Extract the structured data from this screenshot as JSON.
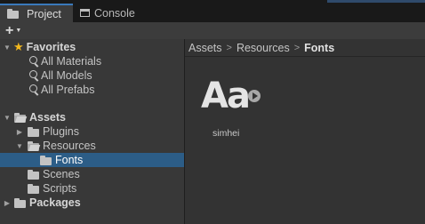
{
  "tabs": [
    {
      "label": "Project",
      "icon": "folder-icon",
      "active": true
    },
    {
      "label": "Console",
      "icon": "console-icon",
      "active": false
    }
  ],
  "toolbar": {
    "create_icon": "plus-icon"
  },
  "tree": {
    "favorites": {
      "label": "Favorites",
      "items": [
        "All Materials",
        "All Models",
        "All Prefabs"
      ]
    },
    "assets": {
      "label": "Assets",
      "plugins": "Plugins",
      "resources": "Resources",
      "fonts": "Fonts",
      "scenes": "Scenes",
      "scripts": "Scripts"
    },
    "packages": {
      "label": "Packages"
    }
  },
  "breadcrumb": {
    "items": [
      "Assets",
      "Resources",
      "Fonts"
    ],
    "separator": ">"
  },
  "asset": {
    "glyph": "Aa",
    "label": "simhei"
  },
  "colors": {
    "selection": "#2c5d87",
    "star": "#f3b81d",
    "tab_accent": "#3a79bb"
  }
}
